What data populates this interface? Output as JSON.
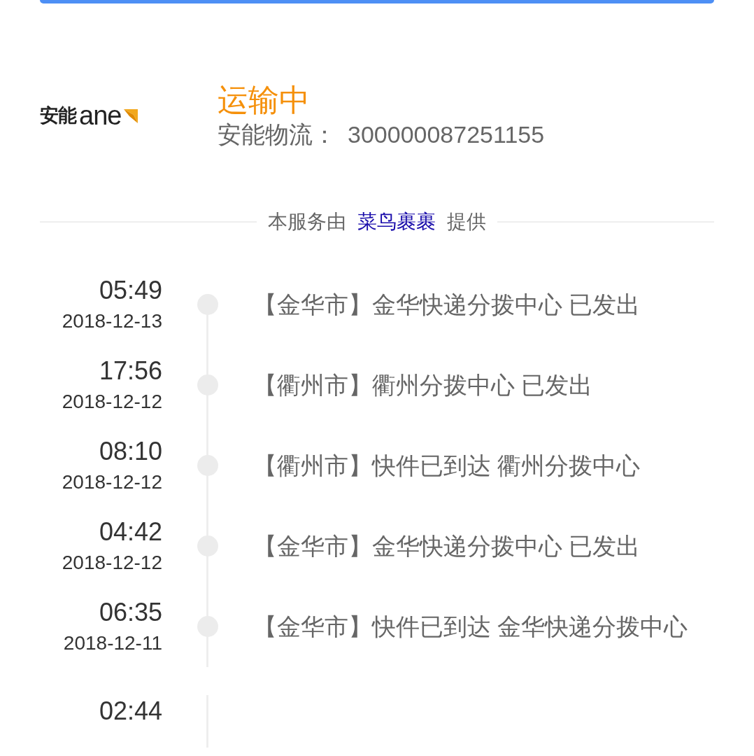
{
  "logo": {
    "name": "安能",
    "latin": "ane"
  },
  "status": "运输中",
  "tracking": {
    "label": "安能物流：",
    "number": "300000087251155"
  },
  "provider": {
    "before": "本服务由",
    "link": "菜鸟裹裹",
    "after": "提供"
  },
  "events": [
    {
      "time": "05:49",
      "date": "2018-12-13",
      "text": "【金华市】金华快递分拨中心 已发出"
    },
    {
      "time": "17:56",
      "date": "2018-12-12",
      "text": "【衢州市】衢州分拨中心 已发出"
    },
    {
      "time": "08:10",
      "date": "2018-12-12",
      "text": "【衢州市】快件已到达 衢州分拨中心"
    },
    {
      "time": "04:42",
      "date": "2018-12-12",
      "text": "【金华市】金华快递分拨中心 已发出"
    },
    {
      "time": "06:35",
      "date": "2018-12-11",
      "text": "【金华市】快件已到达 金华快递分拨中心"
    },
    {
      "time": "02:44"
    }
  ]
}
